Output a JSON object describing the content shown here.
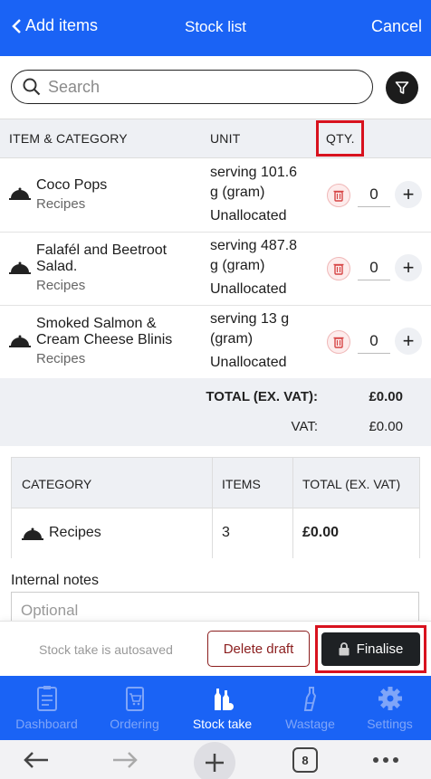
{
  "header": {
    "back_label": "Add items",
    "title": "Stock list",
    "cancel_label": "Cancel",
    "bg_color": "#1a63f5"
  },
  "search": {
    "placeholder": "Search",
    "value": ""
  },
  "table_headers": {
    "item_category": "ITEM & CATEGORY",
    "unit": "UNIT",
    "qty": "QTY."
  },
  "items": [
    {
      "name": "Coco Pops",
      "category": "Recipes",
      "unit_line1": "serving 101.6",
      "unit_line2": "g (gram)",
      "allocation": "Unallocated",
      "qty": "0"
    },
    {
      "name": "Falafél and Beetroot Salad.",
      "category": "Recipes",
      "unit_line1": "serving 487.8",
      "unit_line2": "g (gram)",
      "allocation": "Unallocated",
      "qty": "0"
    },
    {
      "name": "Smoked Salmon & Cream Cheese Blinis",
      "category": "Recipes",
      "unit_line1": "serving 13 g",
      "unit_line2": "(gram)",
      "allocation": "Unallocated",
      "qty": "0"
    }
  ],
  "totals": {
    "total_label": "TOTAL (EX. VAT):",
    "total_value": "£0.00",
    "vat_label": "VAT:",
    "vat_value": "£0.00"
  },
  "summary": {
    "headers": {
      "category": "CATEGORY",
      "items": "ITEMS",
      "total": "TOTAL (EX. VAT)"
    },
    "rows": [
      {
        "category": "Recipes",
        "items": "3",
        "total": "£0.00"
      }
    ]
  },
  "notes": {
    "label": "Internal notes",
    "placeholder": "Optional"
  },
  "actions": {
    "autosave_text": "Stock take is autosaved",
    "delete_label": "Delete draft",
    "finalise_label": "Finalise"
  },
  "nav": [
    {
      "label": "Dashboard",
      "icon": "clipboard-icon",
      "active": false
    },
    {
      "label": "Ordering",
      "icon": "cart-icon",
      "active": false
    },
    {
      "label": "Stock take",
      "icon": "bottles-icon",
      "active": true
    },
    {
      "label": "Wastage",
      "icon": "bin-bottle-icon",
      "active": false
    },
    {
      "label": "Settings",
      "icon": "gear-icon",
      "active": false
    }
  ],
  "browser": {
    "tab_count": "8"
  }
}
